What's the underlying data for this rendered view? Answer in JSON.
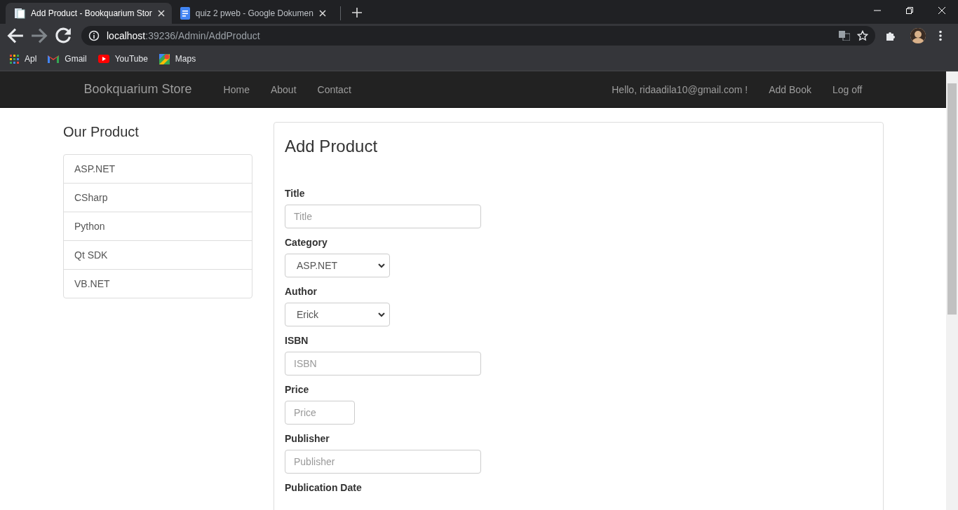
{
  "browser": {
    "tabs": [
      {
        "title": "Add Product - Bookquarium Stor",
        "selected": true,
        "kind": "page"
      },
      {
        "title": "quiz 2 pweb - Google Dokumen",
        "selected": false,
        "kind": "doc"
      }
    ],
    "address": {
      "host": "localhost",
      "path": ":39236/Admin/AddProduct"
    },
    "bookmarks": [
      {
        "label": "Apl",
        "kind": "apps"
      },
      {
        "label": "Gmail",
        "kind": "mail"
      },
      {
        "label": "YouTube",
        "kind": "video"
      },
      {
        "label": "Maps",
        "kind": "maps"
      }
    ]
  },
  "navbar": {
    "brand": "Bookquarium Store",
    "links": [
      "Home",
      "About",
      "Contact"
    ],
    "greeting": "Hello, ridaadila10@gmail.com !",
    "right_links": [
      "Add Book",
      "Log off"
    ]
  },
  "sidebar": {
    "title": "Our Product",
    "items": [
      "ASP.NET",
      "CSharp",
      "Python",
      "Qt SDK",
      "VB.NET"
    ]
  },
  "form": {
    "title": "Add Product",
    "fields": [
      {
        "label": "Title",
        "kind": "text",
        "placeholder": "Title"
      },
      {
        "label": "Category",
        "kind": "select",
        "value": "ASP.NET"
      },
      {
        "label": "Author",
        "kind": "select",
        "value": "Erick"
      },
      {
        "label": "ISBN",
        "kind": "text",
        "placeholder": "ISBN"
      },
      {
        "label": "Price",
        "kind": "text",
        "placeholder": "Price"
      },
      {
        "label": "Publisher",
        "kind": "text",
        "placeholder": "Publisher"
      },
      {
        "label": "Publication Date",
        "kind": "label_only"
      }
    ]
  }
}
